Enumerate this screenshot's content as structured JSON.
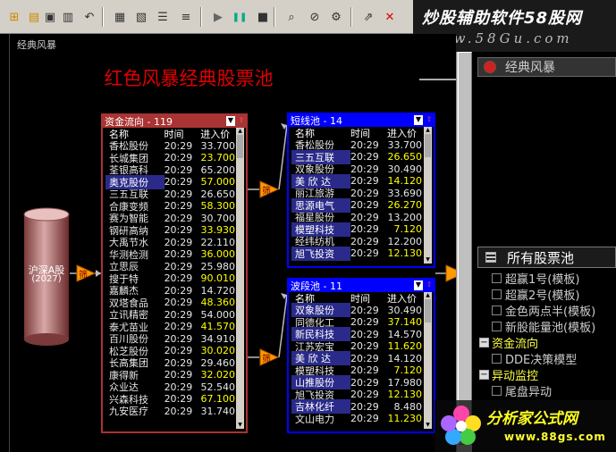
{
  "toolbar": {
    "buttons": [
      "new-icon",
      "open-icon",
      "save-icon",
      "save-all-icon",
      "undo-icon",
      "table-icon",
      "grid-icon",
      "list-icon",
      "sort-icon",
      "play-icon",
      "pause-icon",
      "stop-icon",
      "search-icon",
      "find-replace-icon",
      "settings-icon",
      "external-icon",
      "close-icon"
    ]
  },
  "banner": {
    "line1": "炒股辅助软件58股网",
    "line2": "www.58Gu.com"
  },
  "canvas": {
    "label": "经典风暴",
    "title": "红色风暴经典股票池"
  },
  "source": {
    "label": "沪深A股",
    "count": "(2027)"
  },
  "nodes": {
    "filter_label": "筛"
  },
  "columns": {
    "name": "名称",
    "time": "时间",
    "price": "进入价"
  },
  "pools": {
    "flow": {
      "title": "资金流向 - 119",
      "rows": [
        {
          "name": "香松股份",
          "time": "20:29",
          "price": "33.700"
        },
        {
          "name": "长城集团",
          "time": "20:29",
          "price": "23.700"
        },
        {
          "name": "荃银高科",
          "time": "20:29",
          "price": "65.200"
        },
        {
          "name": "奥克股份",
          "time": "20:29",
          "price": "57.000"
        },
        {
          "name": "三五互联",
          "time": "20:29",
          "price": "26.650"
        },
        {
          "name": "合康变频",
          "time": "20:29",
          "price": "58.300"
        },
        {
          "name": "赛为智能",
          "time": "20:29",
          "price": "30.700"
        },
        {
          "name": "钢研高纳",
          "time": "20:29",
          "price": "33.930"
        },
        {
          "name": "大禹节水",
          "time": "20:29",
          "price": "22.110"
        },
        {
          "name": "华测检测",
          "time": "20:29",
          "price": "36.000"
        },
        {
          "name": "立思辰",
          "time": "20:29",
          "price": "25.980"
        },
        {
          "name": "搜于特",
          "time": "20:29",
          "price": "90.010"
        },
        {
          "name": "嘉麟杰",
          "time": "20:29",
          "price": "14.720"
        },
        {
          "name": "双塔食品",
          "time": "20:29",
          "price": "48.360"
        },
        {
          "name": "立讯精密",
          "time": "20:29",
          "price": "54.000"
        },
        {
          "name": "泰尤苗业",
          "time": "20:29",
          "price": "41.570"
        },
        {
          "name": "百川股份",
          "time": "20:29",
          "price": "34.910"
        },
        {
          "name": "松芝股份",
          "time": "20:29",
          "price": "30.020"
        },
        {
          "name": "长高集团",
          "time": "20:29",
          "price": "29.460"
        },
        {
          "name": "康得新",
          "time": "20:29",
          "price": "32.020"
        },
        {
          "name": "众业达",
          "time": "20:29",
          "price": "52.540"
        },
        {
          "name": "兴森科技",
          "time": "20:29",
          "price": "67.100"
        },
        {
          "name": "九安医疗",
          "time": "20:29",
          "price": "31.740"
        }
      ]
    },
    "short": {
      "title": "短线池 - 14",
      "rows": [
        {
          "name": "香松股份",
          "time": "20:29",
          "price": "33.700"
        },
        {
          "name": "三五互联",
          "time": "20:29",
          "price": "26.650"
        },
        {
          "name": "双象股份",
          "time": "20:29",
          "price": "30.490"
        },
        {
          "name": "美 欣 达",
          "time": "20:29",
          "price": "14.120"
        },
        {
          "name": "丽江旅游",
          "time": "20:29",
          "price": "33.690"
        },
        {
          "name": "思源电气",
          "time": "20:29",
          "price": "26.270"
        },
        {
          "name": "福星股份",
          "time": "20:29",
          "price": "13.200"
        },
        {
          "name": "模塑科技",
          "time": "20:29",
          "price": "7.120"
        },
        {
          "name": "经纬纺机",
          "time": "20:29",
          "price": "12.200"
        },
        {
          "name": "旭飞投资",
          "time": "20:29",
          "price": "12.130"
        }
      ]
    },
    "wave": {
      "title": "波段池 - 11",
      "rows": [
        {
          "name": "双象股份",
          "time": "20:29",
          "price": "30.490"
        },
        {
          "name": "同德化工",
          "time": "20:29",
          "price": "37.140"
        },
        {
          "name": "新民科技",
          "time": "20:29",
          "price": "14.570"
        },
        {
          "name": "江苏宏宝",
          "time": "20:29",
          "price": "11.620"
        },
        {
          "name": "美 欣 达",
          "time": "20:29",
          "price": "14.120"
        },
        {
          "name": "模塑科技",
          "time": "20:29",
          "price": "7.120"
        },
        {
          "name": "山推股份",
          "time": "20:29",
          "price": "17.980"
        },
        {
          "name": "旭飞投资",
          "time": "20:29",
          "price": "12.130"
        },
        {
          "name": "吉林化纤",
          "time": "20:29",
          "price": "8.480"
        },
        {
          "name": "文山电力",
          "time": "20:29",
          "price": "11.230"
        }
      ]
    }
  },
  "right_panel": {
    "header": "经典风暴",
    "pool_header": "所有股票池",
    "items": [
      {
        "type": "item",
        "label": "超赢1号(模板)"
      },
      {
        "type": "item",
        "label": "超赢2号(模板)"
      },
      {
        "type": "item",
        "label": "金色两点半(模板)"
      },
      {
        "type": "item",
        "label": "新股能量池(模板)"
      },
      {
        "type": "group",
        "label": "资金流向"
      },
      {
        "type": "item",
        "label": "DDE决策模型"
      },
      {
        "type": "group",
        "label": "异动监控"
      },
      {
        "type": "item",
        "label": "尾盘异动"
      }
    ]
  },
  "watermark": {
    "line1": "分析家公式网",
    "line2": "www.88gs.com"
  },
  "colors": {
    "flow_border": "#aa3333",
    "pool_border": "#0000ff",
    "title_red": "#dd0000",
    "node_orange": "#ff9900"
  }
}
